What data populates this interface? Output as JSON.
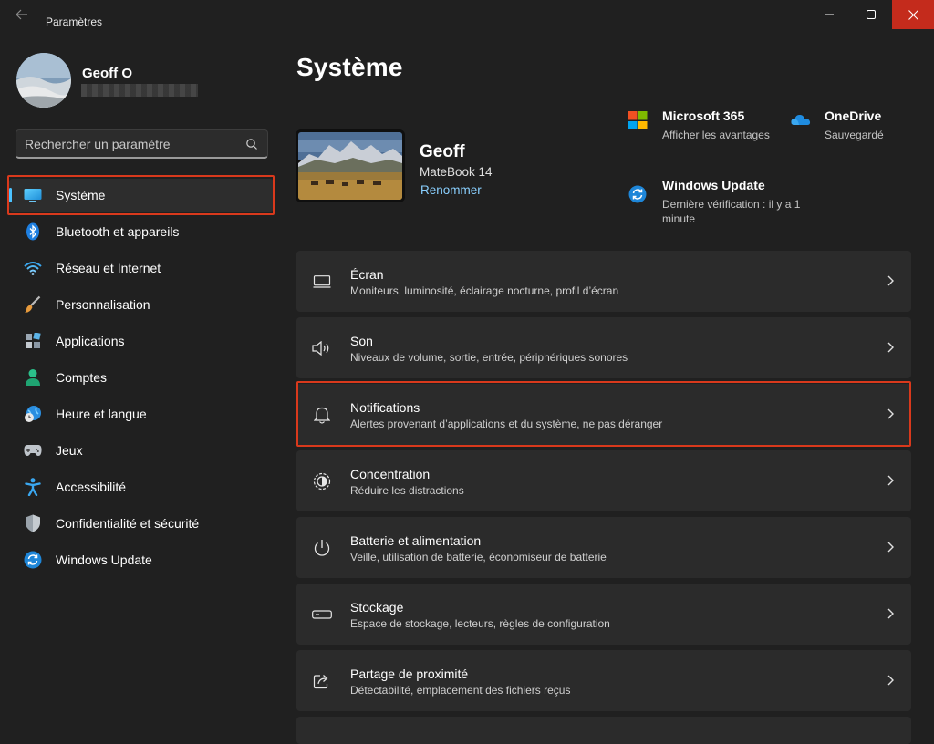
{
  "window": {
    "app_title": "Paramètres"
  },
  "user": {
    "name": "Geoff O"
  },
  "search": {
    "placeholder": "Rechercher un paramètre"
  },
  "sidebar": {
    "items": [
      {
        "label": "Système",
        "icon": "monitor-icon",
        "selected": true
      },
      {
        "label": "Bluetooth et appareils",
        "icon": "bluetooth-icon"
      },
      {
        "label": "Réseau et Internet",
        "icon": "wifi-icon"
      },
      {
        "label": "Personnalisation",
        "icon": "paintbrush-icon"
      },
      {
        "label": "Applications",
        "icon": "apps-icon"
      },
      {
        "label": "Comptes",
        "icon": "person-icon"
      },
      {
        "label": "Heure et langue",
        "icon": "globe-clock-icon"
      },
      {
        "label": "Jeux",
        "icon": "gamepad-icon"
      },
      {
        "label": "Accessibilité",
        "icon": "accessibility-icon"
      },
      {
        "label": "Confidentialité et sécurité",
        "icon": "shield-icon"
      },
      {
        "label": "Windows Update",
        "icon": "sync-icon"
      }
    ]
  },
  "main": {
    "title": "Système",
    "device": {
      "name": "Geoff",
      "model": "MateBook 14",
      "rename_label": "Renommer"
    },
    "quick_links": [
      {
        "title": "Microsoft 365",
        "subtitle": "Afficher les avantages",
        "icon": "microsoft-logo-icon"
      },
      {
        "title": "OneDrive",
        "subtitle": "Sauvegardé",
        "icon": "cloud-icon"
      },
      {
        "title": "Windows Update",
        "subtitle": "Dernière vérification : il y a 1 minute",
        "icon": "sync-icon"
      }
    ],
    "cards": [
      {
        "title": "Écran",
        "subtitle": "Moniteurs, luminosité, éclairage nocturne, profil d’écran",
        "icon": "display-icon"
      },
      {
        "title": "Son",
        "subtitle": "Niveaux de volume, sortie, entrée, périphériques sonores",
        "icon": "speaker-icon"
      },
      {
        "title": "Notifications",
        "subtitle": "Alertes provenant d’applications et du système, ne pas déranger",
        "icon": "bell-icon"
      },
      {
        "title": "Concentration",
        "subtitle": "Réduire les distractions",
        "icon": "focus-icon"
      },
      {
        "title": "Batterie et alimentation",
        "subtitle": "Veille, utilisation de batterie, économiseur de batterie",
        "icon": "power-icon"
      },
      {
        "title": "Stockage",
        "subtitle": "Espace de stockage, lecteurs, règles de configuration",
        "icon": "storage-icon"
      },
      {
        "title": "Partage de proximité",
        "subtitle": "Détectabilité, emplacement des fichiers reçus",
        "icon": "share-icon"
      }
    ]
  },
  "colors": {
    "accent": "#4cc2ff",
    "highlight_outline": "#d9391c",
    "close_button": "#c42b1c",
    "background": "#202020",
    "card": "#2b2b2b"
  }
}
